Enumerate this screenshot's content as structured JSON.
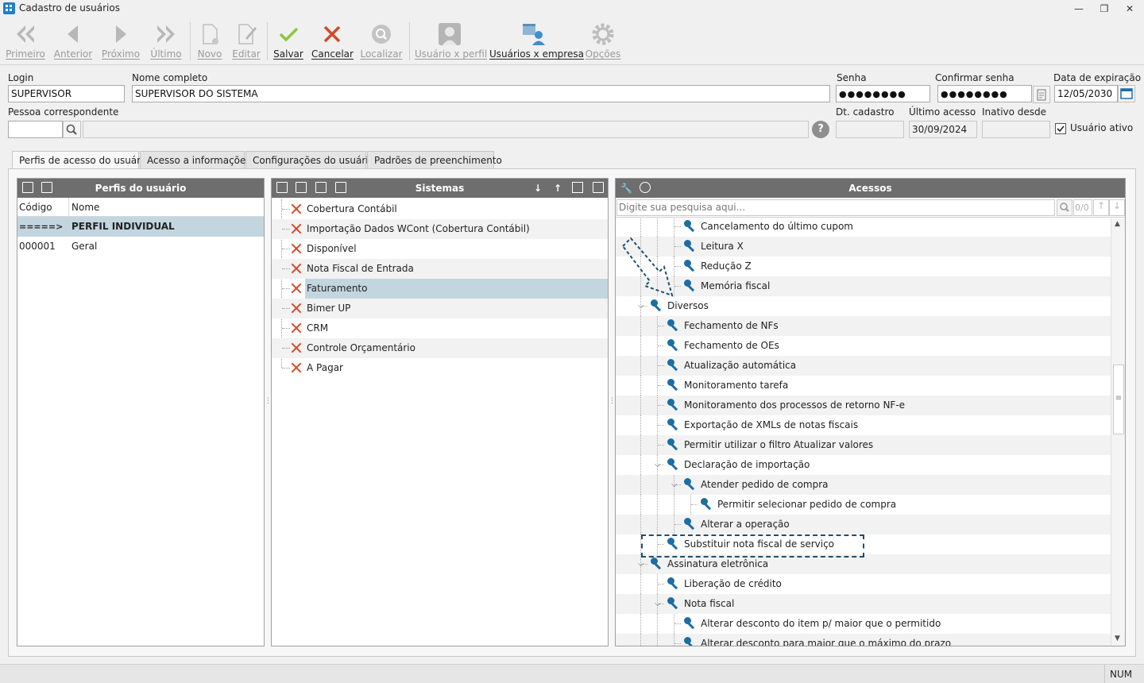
{
  "window": {
    "title": "Cadastro de usuários"
  },
  "toolbar": {
    "first": "Primeiro",
    "previous": "Anterior",
    "next": "Próximo",
    "last": "Último",
    "new": "Novo",
    "edit": "Editar",
    "save": "Salvar",
    "cancel": "Cancelar",
    "find": "Localizar",
    "user_profile": "Usuário x perfil",
    "user_company": "Usuários x empresa",
    "options": "Opções"
  },
  "form": {
    "login_label": "Login",
    "login_value": "SUPERVISOR",
    "fullname_label": "Nome completo",
    "fullname_value": "SUPERVISOR DO SISTEMA",
    "password_label": "Senha",
    "password_value": "●●●●●●●●",
    "confirm_label": "Confirmar senha",
    "confirm_value": "●●●●●●●●",
    "expiration_label": "Data de expiração",
    "expiration_value": "12/05/2030",
    "person_label": "Pessoa correspondente",
    "person_value": "",
    "registered_label": "Dt. cadastro",
    "registered_value": "",
    "last_access_label": "Último acesso",
    "last_access_value": "30/09/2024",
    "inactive_label": "Inativo desde",
    "inactive_value": "",
    "active_label": "Usuário ativo"
  },
  "tabs": [
    "Perfis de acesso do usuário",
    "Acesso a informações",
    "Configurações do usuário",
    "Padrões de preenchimento"
  ],
  "profiles": {
    "title": "Perfis do usuário",
    "columns": [
      "Código",
      "Nome"
    ],
    "rows": [
      {
        "code": "=====>",
        "name": "PERFIL INDIVIDUAL"
      },
      {
        "code": "000001",
        "name": "Geral"
      }
    ]
  },
  "systems": {
    "title": "Sistemas",
    "items": [
      "Cobertura Contábil",
      "Importação Dados WCont (Cobertura Contábil)",
      "Disponível",
      "Nota Fiscal de Entrada",
      "Faturamento",
      "Bimer UP",
      "CRM",
      "Controle Orçamentário",
      "A Pagar"
    ]
  },
  "access": {
    "title": "Acessos",
    "search_placeholder": "Digite sua pesquisa aqui...",
    "search_count": "0/0",
    "items": [
      {
        "label": "Cancelamento do último cupom"
      },
      {
        "label": "Leitura X"
      },
      {
        "label": "Redução Z"
      },
      {
        "label": "Memória fiscal"
      },
      {
        "label": "Diversos"
      },
      {
        "label": "Fechamento de NFs"
      },
      {
        "label": "Fechamento de OEs"
      },
      {
        "label": "Atualização automática"
      },
      {
        "label": "Monitoramento tarefa"
      },
      {
        "label": "Monitoramento dos processos de retorno NF-e"
      },
      {
        "label": "Exportação de XMLs de notas fiscais"
      },
      {
        "label": "Permitir utilizar o filtro Atualizar valores"
      },
      {
        "label": "Declaração de importação"
      },
      {
        "label": "Atender pedido de compra"
      },
      {
        "label": "Permitir selecionar pedido de compra"
      },
      {
        "label": "Alterar a operação"
      },
      {
        "label": "Substituir nota fiscal de serviço"
      },
      {
        "label": "Assinatura eletrônica"
      },
      {
        "label": "Liberação de crédito"
      },
      {
        "label": "Nota fiscal"
      },
      {
        "label": "Alterar desconto do item p/ maior que o permitido"
      },
      {
        "label": "Alterar desconto para maior que o máximo do prazo"
      }
    ]
  },
  "status": {
    "num": "NUM"
  },
  "colors": {
    "header": "#6e6e6e",
    "selection": "#c3d6e0",
    "key_icon": "#1c6ea4",
    "cancel_x": "#d24a2a",
    "save_check": "#8cc63f"
  }
}
